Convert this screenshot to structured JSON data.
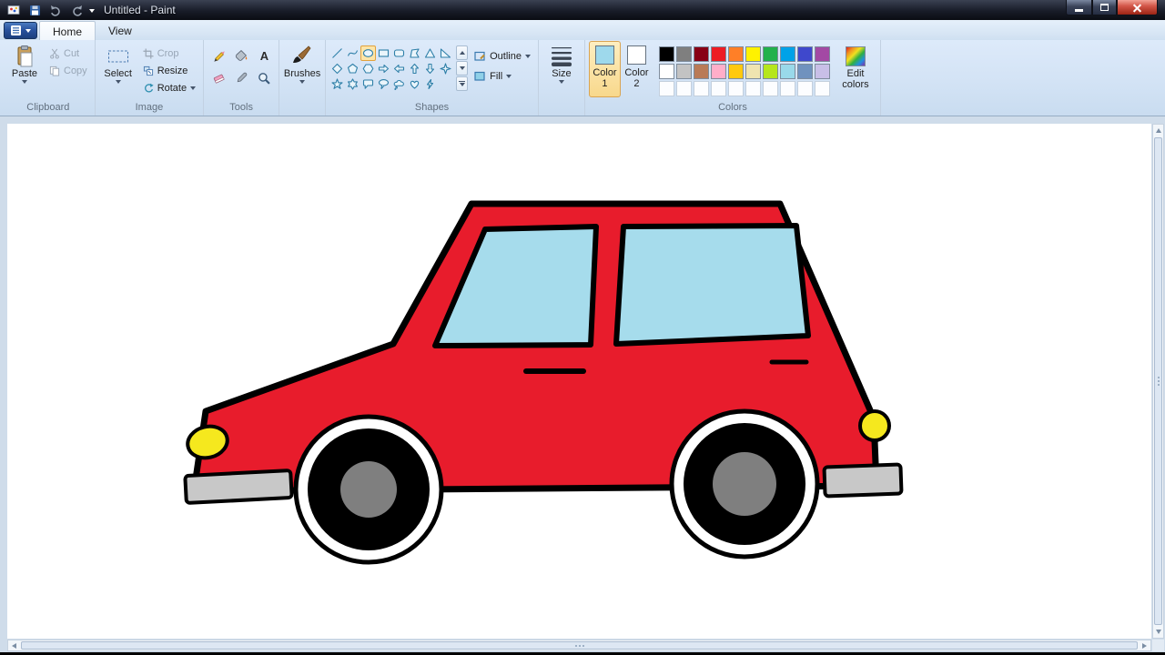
{
  "window": {
    "title": "Untitled - Paint"
  },
  "tabs": {
    "home": "Home",
    "view": "View"
  },
  "ribbon": {
    "clipboard": {
      "group_label": "Clipboard",
      "paste": "Paste",
      "cut": "Cut",
      "copy": "Copy"
    },
    "image": {
      "group_label": "Image",
      "select": "Select",
      "crop": "Crop",
      "resize": "Resize",
      "rotate": "Rotate"
    },
    "tools": {
      "group_label": "Tools",
      "tools": [
        "pencil",
        "fill-with-color",
        "text",
        "eraser",
        "color-picker",
        "magnifier"
      ]
    },
    "brushes": {
      "label": "Brushes"
    },
    "shapes": {
      "group_label": "Shapes",
      "outline": "Outline",
      "fill": "Fill",
      "selected_shape": "oval",
      "items": [
        "line",
        "curve",
        "oval",
        "rectangle",
        "rounded-rectangle",
        "polygon",
        "triangle",
        "right-triangle",
        "diamond",
        "pentagon",
        "hexagon",
        "arrow-right",
        "arrow-left",
        "arrow-up",
        "arrow-down",
        "star-4-point",
        "star-5-point",
        "star-6-point",
        "callout-rounded",
        "callout-oval",
        "callout-cloud",
        "heart",
        "lightning"
      ]
    },
    "size": {
      "label": "Size"
    },
    "colors": {
      "group_label": "Colors",
      "color1_label": "Color 1",
      "color2_label": "Color 2",
      "color1_value": "#9ed9ec",
      "color2_value": "#ffffff",
      "edit_colors_label": "Edit colors",
      "palette_row1": [
        "#000000",
        "#7f7f7f",
        "#880015",
        "#ed1c24",
        "#ff7f27",
        "#fff200",
        "#22b14c",
        "#00a2e8",
        "#3f48cc",
        "#a349a4"
      ],
      "palette_row2": [
        "#ffffff",
        "#c3c3c3",
        "#b97a57",
        "#ffaec9",
        "#ffc90e",
        "#efe4b0",
        "#b5e61d",
        "#99d9ea",
        "#7092be",
        "#c8bfe7"
      ],
      "palette_row3": [
        "",
        "",
        "",
        "",
        "",
        "",
        "",
        "",
        "",
        ""
      ]
    }
  },
  "canvas": {
    "subject": "red cartoon car drawing",
    "car_colors": {
      "body": "#e81c2c",
      "windows": "#a6dcec",
      "wheels": "#000000",
      "hubcaps": "#7f7f7f",
      "wheel_arches": "#ffffff",
      "bumpers": "#c8c8c8",
      "lights": "#f5e81e",
      "outline": "#000000"
    }
  }
}
